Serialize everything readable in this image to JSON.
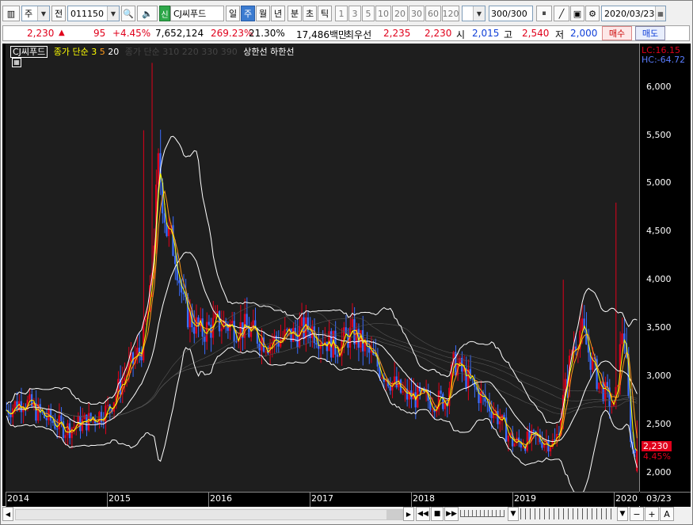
{
  "toolbar": {
    "period_type": "주",
    "prev_label": "전",
    "code": "011150",
    "badge": "신",
    "stock_name": "CJ씨푸드",
    "periods": [
      "일",
      "주",
      "월",
      "년"
    ],
    "selected_period": "주",
    "minute_tabs": [
      "분",
      "초",
      "틱"
    ],
    "numbers": [
      "1",
      "3",
      "5",
      "10",
      "20",
      "30",
      "60",
      "120"
    ],
    "count": "300",
    "count_total": "/300",
    "date": "2020/03/23"
  },
  "quote": {
    "price": "2,230",
    "change": "95",
    "change_pct": "+4.45%",
    "volume": "7,652,124",
    "vol_ratio": "269.23%",
    "turnover": "21.30%",
    "amount": "17,486백만",
    "best_label": "최우선",
    "best_ask": "2,235",
    "best_bid": "2,230",
    "open_label": "시",
    "open": "2,015",
    "high_label": "고",
    "high": "2,540",
    "low_label": "저",
    "low": "2,000",
    "buy_button": "매수",
    "sell_button": "매도"
  },
  "legend": {
    "name": "CJ씨푸드",
    "ma_label": "종가 단순",
    "ma_periods": [
      "3",
      "5",
      "20"
    ],
    "ma_long": "종가 단순 310 220 330 390",
    "upper": "상한선",
    "lower": "하한선"
  },
  "chart_info": {
    "lc": "LC:16.15",
    "hc": "HC:-64.72",
    "last_price": "2,230",
    "last_pct": "4.45%"
  },
  "colors": {
    "up": "#e0001b",
    "down": "#3a6cff",
    "ma3": "#ffff00",
    "ma5": "#ff9a1a",
    "ma20": "#ffffff",
    "bg": "#1e1e1e"
  },
  "chart_data": {
    "type": "candlestick",
    "y_ticks": [
      "6,000",
      "5,500",
      "5,000",
      "4,500",
      "4,000",
      "3,500",
      "3,000",
      "2,500",
      "2,000"
    ],
    "x_ticks": [
      "2014",
      "2015",
      "2016",
      "2017",
      "2018",
      "2019",
      "2020",
      "03/23"
    ],
    "ylim": [
      1800,
      6450
    ],
    "close_path": [
      [
        "2014-01",
        2650
      ],
      [
        "2014-03",
        2750
      ],
      [
        "2014-05",
        2600
      ],
      [
        "2014-08",
        2450
      ],
      [
        "2014-11",
        2550
      ],
      [
        "2015-01",
        2650
      ],
      [
        "2015-03",
        3000
      ],
      [
        "2015-05",
        3300
      ],
      [
        "2015-06",
        3800
      ],
      [
        "2015-07",
        5200
      ],
      [
        "2015-08",
        4500
      ],
      [
        "2015-09",
        4300
      ],
      [
        "2015-10",
        3700
      ],
      [
        "2015-12",
        3450
      ],
      [
        "2016-02",
        3550
      ],
      [
        "2016-05",
        3500
      ],
      [
        "2016-08",
        3350
      ],
      [
        "2016-10",
        3400
      ],
      [
        "2017-01",
        3500
      ],
      [
        "2017-04",
        3300
      ],
      [
        "2017-06",
        3450
      ],
      [
        "2017-09",
        3100
      ],
      [
        "2017-12",
        2800
      ],
      [
        "2018-03",
        2750
      ],
      [
        "2018-05",
        2750
      ],
      [
        "2018-06",
        3150
      ],
      [
        "2018-09",
        2800
      ],
      [
        "2018-11",
        2600
      ],
      [
        "2019-01",
        2300
      ],
      [
        "2019-04",
        2350
      ],
      [
        "2019-06",
        2300
      ],
      [
        "2019-08",
        3300
      ],
      [
        "2019-09",
        3500
      ],
      [
        "2019-11",
        2950
      ],
      [
        "2020-01",
        2650
      ],
      [
        "2020-02",
        3600
      ],
      [
        "2020-03",
        2230
      ]
    ]
  },
  "scroll": {
    "plus": "+",
    "minus": "−",
    "a": "A"
  }
}
